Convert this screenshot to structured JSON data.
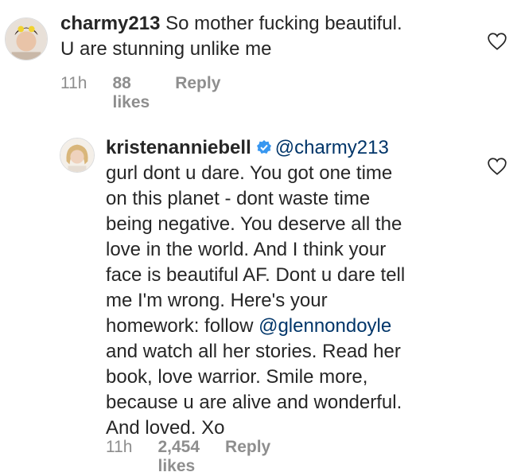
{
  "comments": [
    {
      "username": "charmy213",
      "text_lines": [
        "So mother fucking beautiful.",
        "U are stunning unlike me"
      ],
      "time": "11h",
      "likes": "88 likes",
      "reply": "Reply",
      "verified": false
    },
    {
      "username": "kristenanniebell",
      "verified": true,
      "mention": "@charmy213",
      "text_lines": [
        "gurl dont u dare. You got one time",
        "on this planet - dont waste time",
        "being negative. You deserve all the",
        "love in the world. And I think your",
        "face is beautiful AF. Dont u dare tell",
        "me I'm wrong. Here's your",
        "homework: follow ",
        "and watch all her stories. Read her",
        "book, love warrior. Smile more,",
        "because u are alive and wonderful.",
        "And loved. Xo"
      ],
      "inline_mention": "@glennondoyle",
      "time": "11h",
      "likes": "2,454 likes",
      "reply": "Reply"
    }
  ],
  "colors": {
    "text": "#262626",
    "meta": "#8e8e8e",
    "mention": "#003569",
    "verified": "#3897f0"
  }
}
